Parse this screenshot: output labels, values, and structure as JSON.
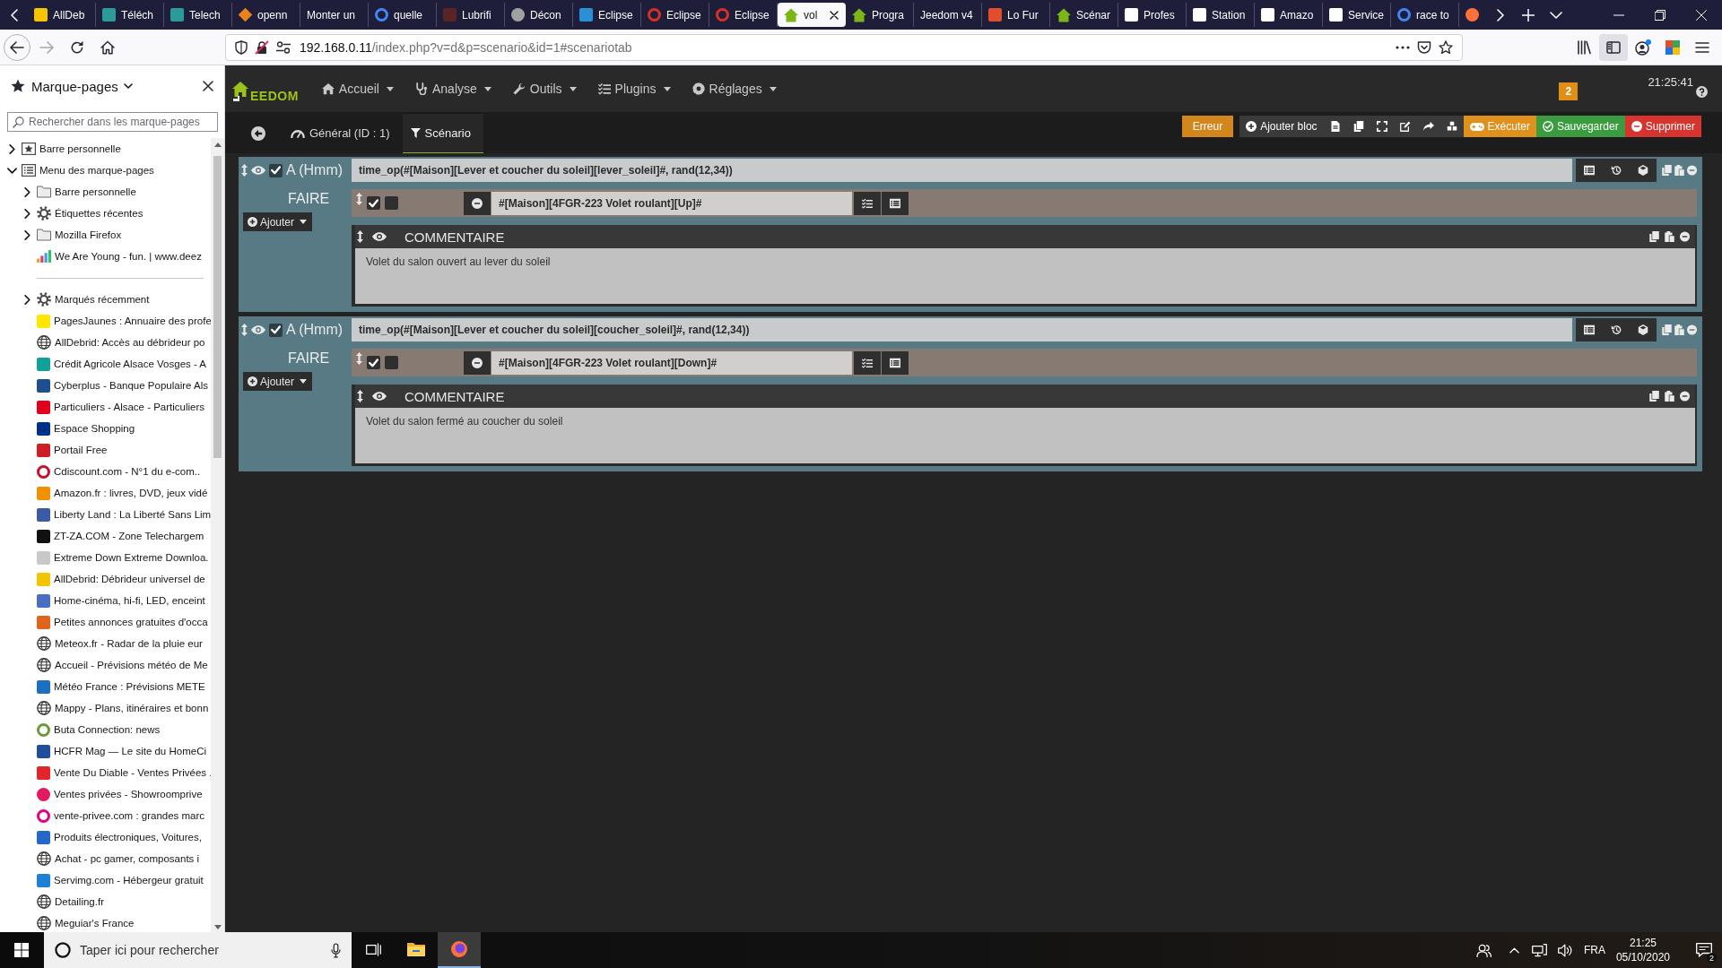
{
  "browser": {
    "tabs": [
      {
        "label": "AllDeb",
        "kind": "tile",
        "color": "#f5c400",
        "selected": false
      },
      {
        "label": "Téléch",
        "kind": "tile",
        "color": "#2a9a9a",
        "selected": false
      },
      {
        "label": "Telech",
        "kind": "tile",
        "color": "#2a9a9a",
        "selected": false
      },
      {
        "label": "openn",
        "kind": "diamond",
        "color": "#e8821e",
        "selected": false
      },
      {
        "label": "Monter un",
        "kind": "blank",
        "selected": false
      },
      {
        "label": "quelle",
        "kind": "ring",
        "color": "#4285f4",
        "selected": false
      },
      {
        "label": "Lubrifi",
        "kind": "tile",
        "color": "#5a2424",
        "selected": false
      },
      {
        "label": "Décon",
        "kind": "ball",
        "color": "#a0a0a0",
        "selected": false
      },
      {
        "label": "Eclipse",
        "kind": "tile",
        "color": "#2b8fd6",
        "selected": false
      },
      {
        "label": "Eclipse",
        "kind": "ring",
        "color": "#d93025",
        "selected": false
      },
      {
        "label": "Eclipse",
        "kind": "ring",
        "color": "#d93025",
        "selected": false
      },
      {
        "label": "vol",
        "kind": "house",
        "color": "#7cb518",
        "selected": true
      },
      {
        "label": "Progra",
        "kind": "house",
        "color": "#7cb518",
        "selected": false
      },
      {
        "label": "Jeedom v4",
        "kind": "blank",
        "selected": false
      },
      {
        "label": "Lo Fur",
        "kind": "tile",
        "color": "#e24d2c",
        "selected": false
      },
      {
        "label": "Scénar",
        "kind": "house",
        "color": "#7cb518",
        "selected": false
      },
      {
        "label": "Profes",
        "kind": "tile",
        "color": "#ffffff",
        "selected": false
      },
      {
        "label": "Station",
        "kind": "tile",
        "color": "#ffffff",
        "selected": false
      },
      {
        "label": "Amazo",
        "kind": "tile",
        "color": "#ffffff",
        "selected": false
      },
      {
        "label": "Service",
        "kind": "tile",
        "color": "#ffffff",
        "selected": false
      },
      {
        "label": "race to",
        "kind": "ring",
        "color": "#4285f4",
        "selected": false
      },
      {
        "kind": "ball",
        "color": "#ff7139",
        "selected": false
      }
    ],
    "forward_disabled": true,
    "url": {
      "host": "192.168.0.11",
      "path": "/index.php?v=d&p=scenario&id=1#scenariotab"
    },
    "sidebar_button": {
      "on": true
    }
  },
  "sidebar": {
    "title": "Marque-pages",
    "search_placeholder": "Rechercher dans les marque-pages",
    "items": [
      {
        "label": "Barre personnelle",
        "kind": "starbox",
        "expanded": false
      },
      {
        "label": "Menu des marque-pages",
        "kind": "list",
        "expanded": true,
        "children": [
          {
            "label": "Barre personnelle",
            "kind": "folder",
            "expanded": false
          },
          {
            "label": "Étiquettes récentes",
            "kind": "gear",
            "expanded": false
          },
          {
            "label": "Mozilla Firefox",
            "kind": "folder",
            "expanded": false
          },
          {
            "label": "We Are Young - fun. | www.deez",
            "kind": "bars"
          },
          {
            "kind": "separator"
          },
          {
            "label": "Marqués récemment",
            "kind": "gear",
            "expanded": false
          },
          {
            "label": "PagesJaunes : Annuaire des profe",
            "kind": "tile",
            "color": "#ffe600"
          },
          {
            "label": "AllDebrid: Accès au débrideur po",
            "kind": "globe"
          },
          {
            "label": "Crédit Agricole Alsace Vosges - A",
            "kind": "tile",
            "color": "#12a19a"
          },
          {
            "label": "Cyberplus - Banque Populaire Als",
            "kind": "tile",
            "color": "#1d4f91"
          },
          {
            "label": "Particuliers - Alsace - Particuliers",
            "kind": "tile",
            "color": "#e2001a"
          },
          {
            "label": "Espace Shopping",
            "kind": "tile",
            "color": "#003087"
          },
          {
            "label": "Portail Free",
            "kind": "tile",
            "color": "#cd1e25"
          },
          {
            "label": "Cdiscount.com - N°1 du e-com..",
            "kind": "ring",
            "color": "#c8102e"
          },
          {
            "label": "Amazon.fr : livres, DVD, jeux vidé",
            "kind": "tile",
            "color": "#f29100"
          },
          {
            "label": "Liberty Land : La Liberté Sans Lim",
            "kind": "tile",
            "color": "#3b5ba5"
          },
          {
            "label": "ZT-ZA.COM - Zone Telechargem",
            "kind": "tile",
            "color": "#111111"
          },
          {
            "label": "Extreme Down Extreme Downloa.",
            "kind": "tile",
            "color": "#c8c8c8"
          },
          {
            "label": "AllDebrid: Débrideur universel de",
            "kind": "tile",
            "color": "#f5c400"
          },
          {
            "label": "Home-cinéma, hi-fi, LED, enceint",
            "kind": "tile",
            "color": "#4a6fc0"
          },
          {
            "label": "Petites annonces gratuites d'occa",
            "kind": "tile",
            "color": "#e0641b"
          },
          {
            "label": "Meteox.fr - Radar de la pluie eur",
            "kind": "globe"
          },
          {
            "label": "Accueil - Prévisions météo de Me",
            "kind": "globe"
          },
          {
            "label": "Météo France : Prévisions METE",
            "kind": "tile",
            "color": "#1e6fbf"
          },
          {
            "label": "Mappy - Plans, itinéraires et bonn",
            "kind": "globe"
          },
          {
            "label": "Buta Connection: news",
            "kind": "ring",
            "color": "#6a9a3a"
          },
          {
            "label": "HCFR Mag — Le site du HomeCi",
            "kind": "tile",
            "color": "#1f4e9c"
          },
          {
            "label": "Vente Du Diable - Ventes Privées .",
            "kind": "tile",
            "color": "#e3242b"
          },
          {
            "label": "Ventes privées - Showroomprive",
            "kind": "ball",
            "color": "#e5195f"
          },
          {
            "label": "vente-privee.com : grandes marc",
            "kind": "ring",
            "color": "#e6007e"
          },
          {
            "label": "Produits électroniques, Voitures,",
            "kind": "tile",
            "color": "#2469c9"
          },
          {
            "label": "Achat - pc gamer, composants i",
            "kind": "globe"
          },
          {
            "label": "Servimg.com - Hébergeur gratuit",
            "kind": "tile",
            "color": "#1e7fd6"
          },
          {
            "label": "Detailing.fr",
            "kind": "globe"
          },
          {
            "label": "Meguiar's France",
            "kind": "globe"
          }
        ]
      }
    ]
  },
  "jeedom": {
    "logo": "EEDOM",
    "menu": [
      {
        "label": "Accueil",
        "kind": "home"
      },
      {
        "label": "Analyse",
        "kind": "stethoscope"
      },
      {
        "label": "Outils",
        "kind": "wrench"
      },
      {
        "label": "Plugins",
        "kind": "tasks"
      },
      {
        "label": "Réglages",
        "kind": "cogs"
      }
    ],
    "badge": "2",
    "clock": "21:25:41",
    "tabs": [
      {
        "label": "Général (ID : 1)",
        "kind": "gauge",
        "selected": false
      },
      {
        "label": "Scénario",
        "kind": "filter",
        "selected": true
      }
    ],
    "actions": {
      "error": "Erreur",
      "add_block": "Ajouter bloc",
      "run": "Exécuter",
      "save": "Sauvegarder",
      "delete": "Supprimer"
    },
    "blocks": [
      {
        "label": "A (Hmm)",
        "enabled": true,
        "expression": "time_op(#[Maison][Lever et coucher du soleil][lever_soleil]#, rand(12,34))",
        "section": "FAIRE",
        "add": "Ajouter",
        "children": [
          {
            "kind": "action",
            "enabled": true,
            "parallel": false,
            "command": "#[Maison][4FGR-223 Volet roulant][Up]#"
          },
          {
            "kind": "comment",
            "title": "COMMENTAIRE",
            "text": "Volet du salon ouvert au lever du soleil"
          }
        ]
      },
      {
        "label": "A (Hmm)",
        "enabled": true,
        "expression": "time_op(#[Maison][Lever et coucher du soleil][coucher_soleil]#, rand(12,34))",
        "section": "FAIRE",
        "add": "Ajouter",
        "children": [
          {
            "kind": "action",
            "enabled": true,
            "parallel": false,
            "command": "#[Maison][4FGR-223 Volet roulant][Down]#"
          },
          {
            "kind": "comment",
            "title": "COMMENTAIRE",
            "text": "Volet du salon fermé au coucher du soleil"
          }
        ]
      }
    ]
  },
  "taskbar": {
    "search_placeholder": "Taper ici pour rechercher",
    "apps": [
      {
        "kind": "taskview",
        "selected": false
      },
      {
        "kind": "explorer",
        "selected": false
      },
      {
        "kind": "firefox",
        "selected": true
      }
    ],
    "language": "FRA",
    "time": "21:25",
    "date": "05/10/2020",
    "notifications": "2"
  }
}
